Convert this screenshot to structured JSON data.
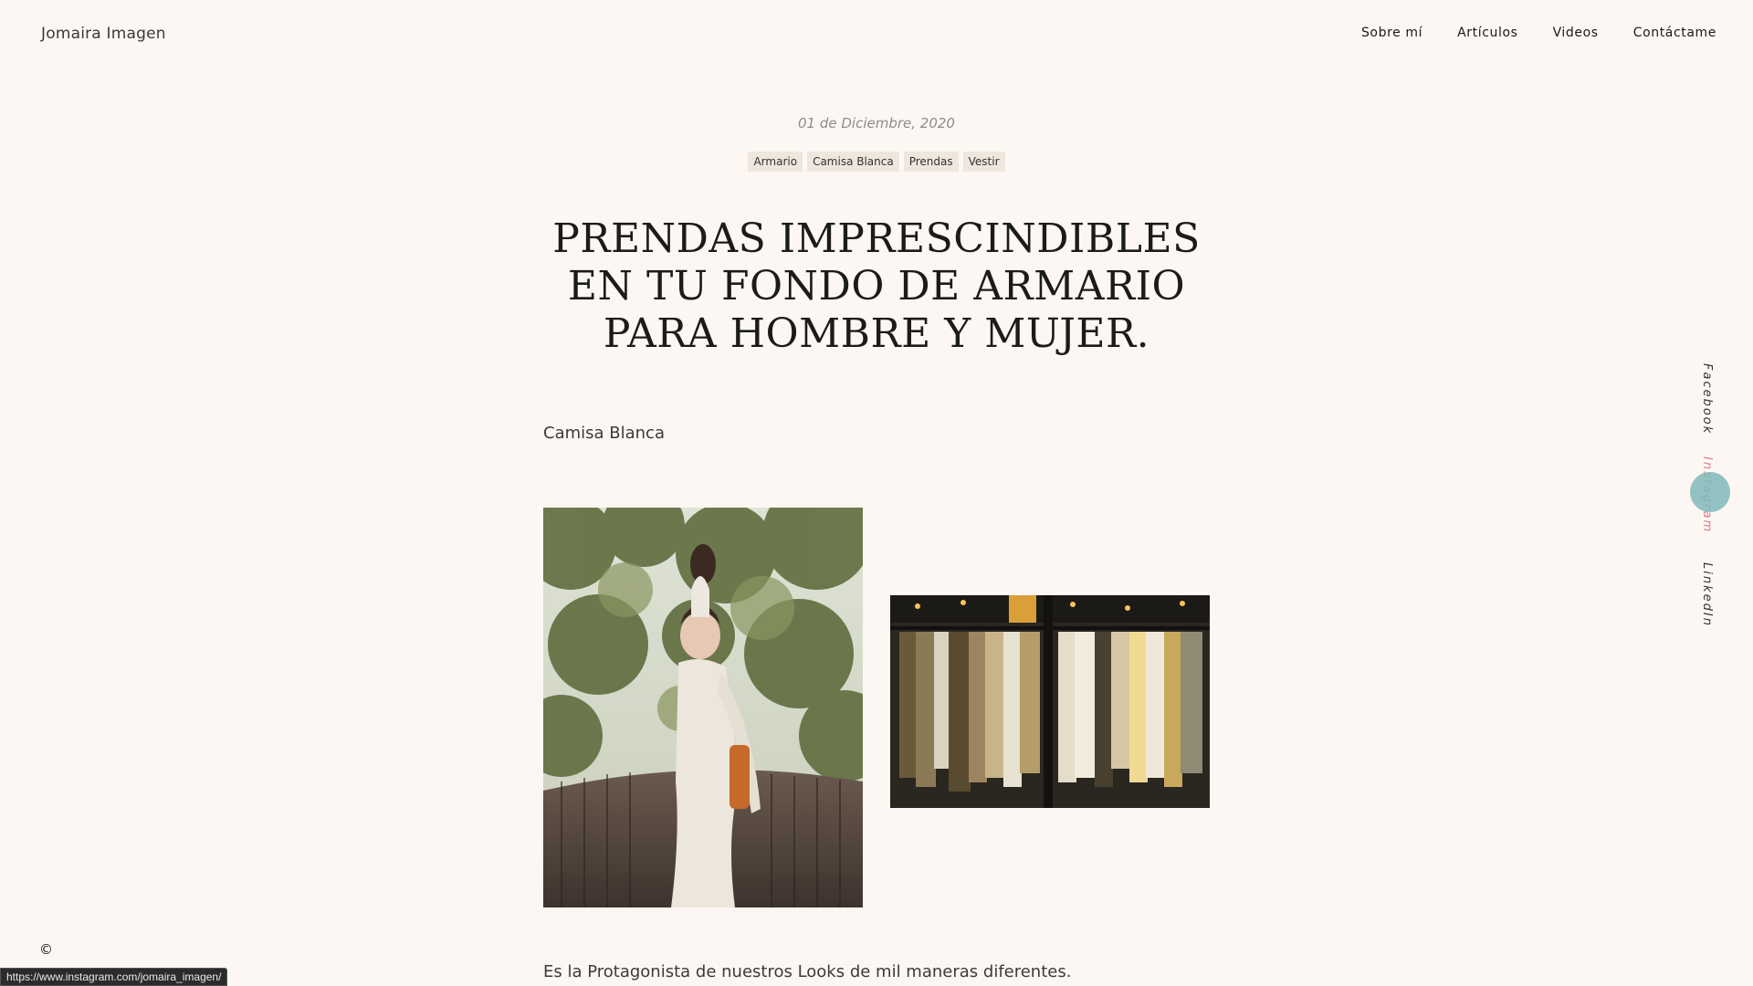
{
  "header": {
    "brand": "Jomaira Imagen",
    "nav": [
      "Sobre mí",
      "Artículos",
      "Videos",
      "Contáctame"
    ]
  },
  "post": {
    "date": "01 de Diciembre, 2020",
    "tags": [
      "Armario",
      "Camisa Blanca",
      "Prendas",
      "Vestir"
    ],
    "title": "PRENDAS IMPRESCINDIBLES EN TU FONDO DE ARMARIO PARA HOMBRE Y MUJER.",
    "subheading": "Camisa Blanca",
    "body": "Es la Protagonista de nuestros Looks de mil maneras diferentes."
  },
  "social": [
    "Facebook",
    "Instagram",
    "LinkedIn"
  ],
  "footer": {
    "copyright": "©"
  },
  "status_bar": {
    "url": "https://www.instagram.com/jomaira_imagen/"
  },
  "colors": {
    "background": "#fcf7f2",
    "tag_bg": "#efe6dd",
    "instagram_hover": "#e07a8f",
    "cursor_dot": "#7fb8b8"
  }
}
